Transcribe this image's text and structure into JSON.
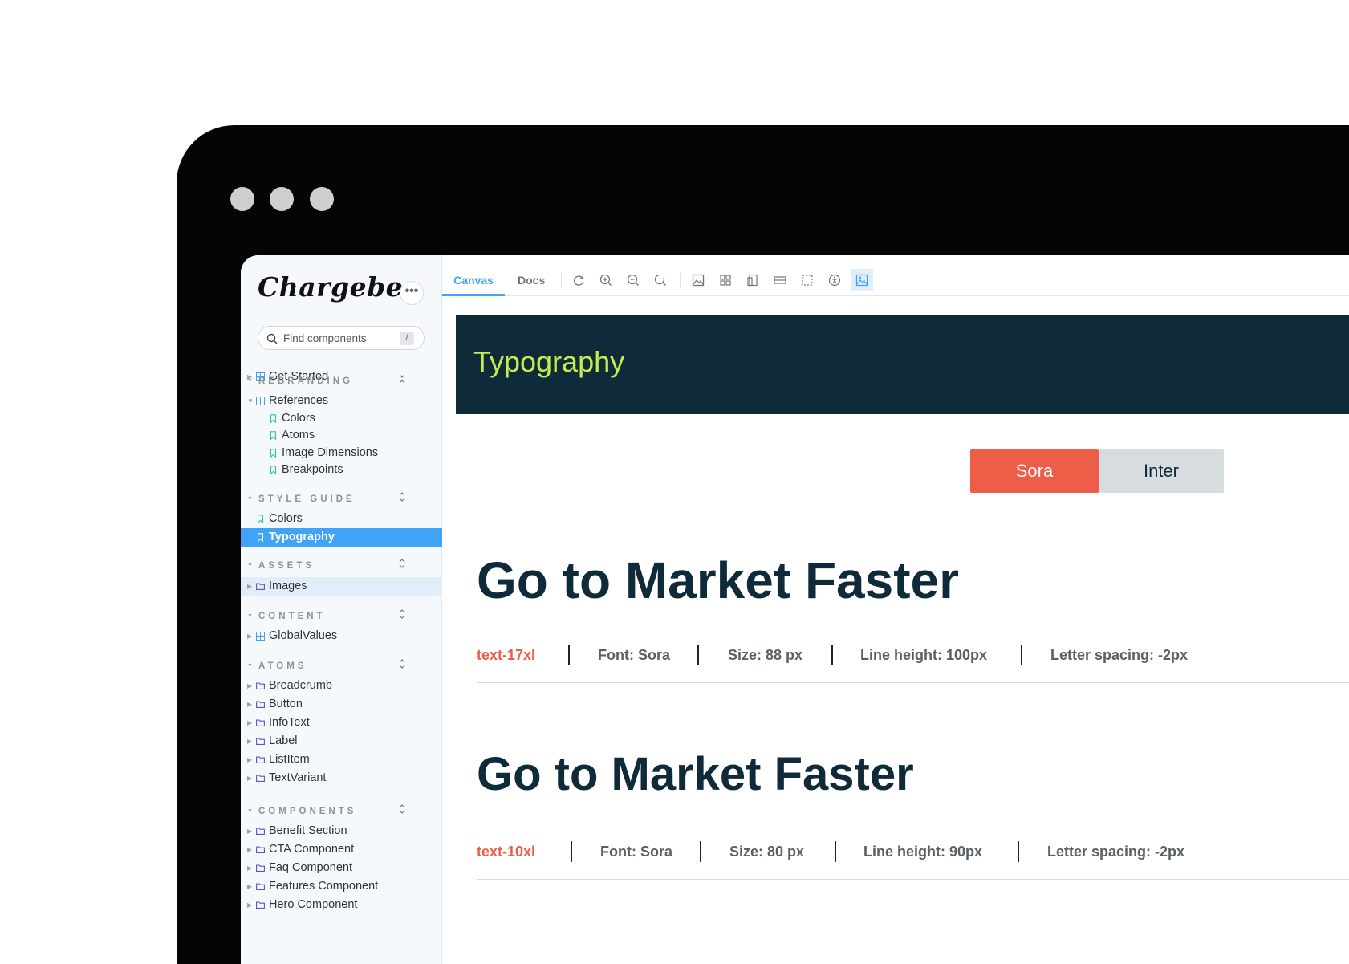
{
  "app": {
    "logo_text": "Chargebee",
    "more_label": "•••",
    "search": {
      "placeholder": "Find components",
      "shortcut": "/"
    }
  },
  "sidebar": {
    "get_started": "Get Started",
    "rebranding": {
      "title": "REBRANDING",
      "references": "References",
      "children": [
        "Colors",
        "Atoms",
        "Image Dimensions",
        "Breakpoints"
      ]
    },
    "style_guide": {
      "title": "STYLE GUIDE",
      "items": [
        "Colors",
        "Typography"
      ]
    },
    "assets": {
      "title": "ASSETS",
      "items": [
        "Images"
      ]
    },
    "content": {
      "title": "CONTENT",
      "items": [
        "GlobalValues"
      ]
    },
    "atoms": {
      "title": "ATOMS",
      "items": [
        "Breadcrumb",
        "Button",
        "InfoText",
        "Label",
        "ListItem",
        "TextVariant"
      ]
    },
    "components": {
      "title": "COMPONENTS",
      "items": [
        "Benefit Section",
        "CTA Component",
        "Faq Component",
        "Features Component",
        "Hero Component"
      ]
    }
  },
  "toolbar": {
    "tabs": [
      "Canvas",
      "Docs"
    ],
    "icons": [
      "reload-icon",
      "zoom-in-icon",
      "zoom-out-icon",
      "reset-zoom-icon",
      "background-icon",
      "grid-icon",
      "viewport-icon",
      "measure-icon",
      "outline-icon",
      "accessibility-icon",
      "image-icon"
    ]
  },
  "canvas": {
    "banner_title": "Typography",
    "font_toggle": [
      "Sora",
      "Inter"
    ],
    "samples": [
      {
        "text": "Go to Market Faster",
        "class_name": "text-17xl",
        "font": "Font: Sora",
        "size": "Size: 88 px",
        "line_height": "Line height: 100px",
        "letter_spacing": "Letter spacing: -2px"
      },
      {
        "text": "Go to Market Faster",
        "class_name": "text-10xl",
        "font": "Font: Sora",
        "size": "Size: 80 px",
        "line_height": "Line height: 90px",
        "letter_spacing": "Letter spacing: -2px"
      }
    ]
  },
  "colors": {
    "accent": "#3fa3f8",
    "banner_bg": "#0f2b3a",
    "banner_text": "#c6ec52",
    "sora_active": "#ee5d48",
    "heading": "#0f2b3a"
  }
}
